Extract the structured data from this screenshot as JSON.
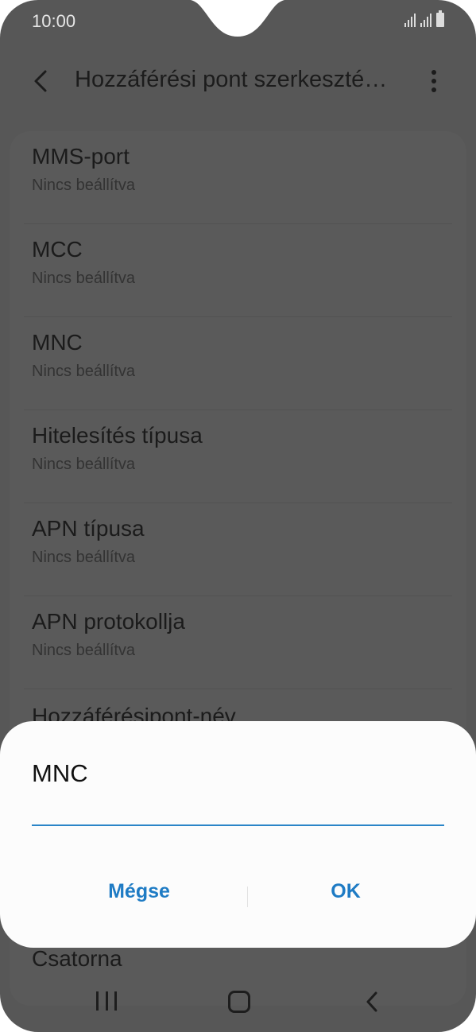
{
  "status_bar": {
    "time": "10:00"
  },
  "header": {
    "title": "Hozzáférési pont szerkeszté…",
    "back_icon": "chevron-left-icon",
    "more_icon": "more-vertical-icon"
  },
  "list": {
    "items": [
      {
        "label": "MMS-port",
        "value": "Nincs beállítva"
      },
      {
        "label": "MCC",
        "value": "Nincs beállítva"
      },
      {
        "label": "MNC",
        "value": "Nincs beállítva"
      },
      {
        "label": "Hitelesítés típusa",
        "value": "Nincs beállítva"
      },
      {
        "label": "APN típusa",
        "value": "Nincs beállítva"
      },
      {
        "label": "APN protokollja",
        "value": "Nincs beállítva"
      }
    ],
    "partial_item_label": "Hozzáférésipont-név",
    "bottom_item_label": "Csatorna"
  },
  "dialog": {
    "title": "MNC",
    "input_value": "",
    "cancel_label": "Mégse",
    "ok_label": "OK"
  },
  "colors": {
    "accent": "#1e7bc4",
    "input_underline": "#2a85c8",
    "dim_background": "#575757"
  },
  "nav_bar": {
    "recents_icon": "recents-icon",
    "home_icon": "home-icon",
    "back_icon": "back-icon"
  }
}
